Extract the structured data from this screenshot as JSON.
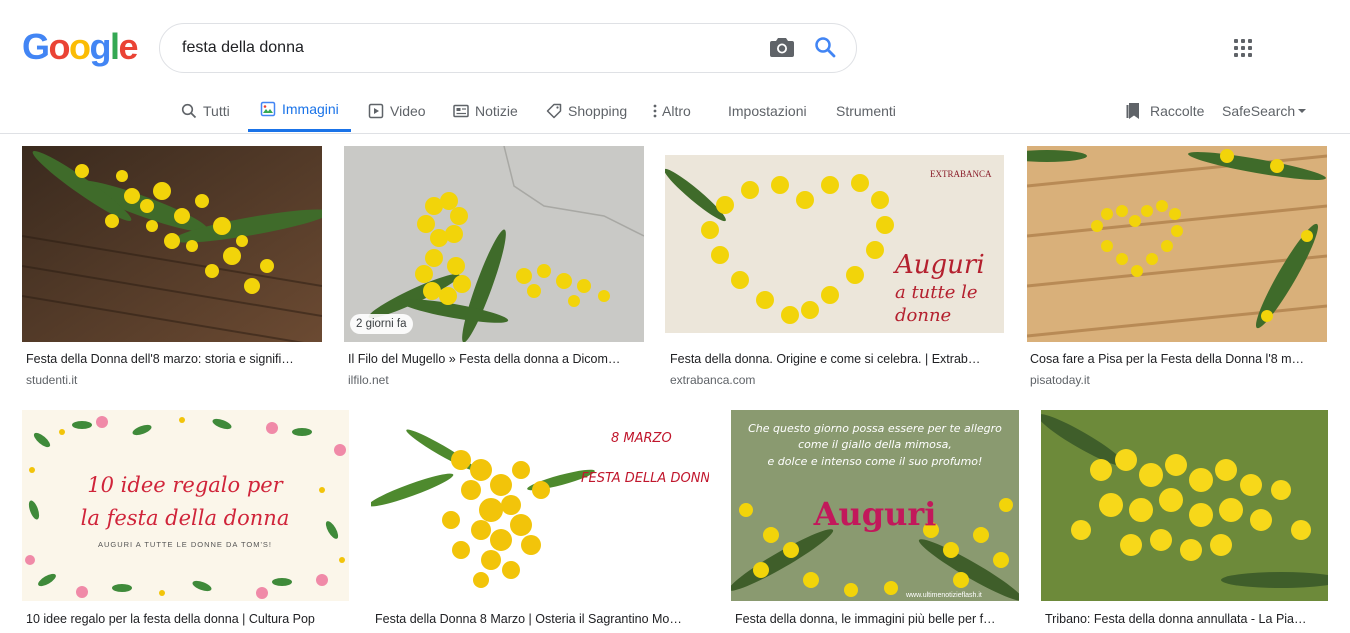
{
  "logo": {
    "letters": [
      "G",
      "o",
      "o",
      "g",
      "l",
      "e"
    ],
    "colors": [
      "#4285f4",
      "#ea4335",
      "#fbbc05",
      "#4285f4",
      "#34a853",
      "#ea4335"
    ]
  },
  "search": {
    "value": "festa della donna",
    "camera_icon": "camera-icon",
    "search_icon": "search-icon"
  },
  "apps_icon": "apps-grid-icon",
  "tabs": [
    {
      "label": "Tutti",
      "icon": "search-icon"
    },
    {
      "label": "Immagini",
      "icon": "image-icon"
    },
    {
      "label": "Video",
      "icon": "play-icon"
    },
    {
      "label": "Notizie",
      "icon": "news-icon"
    },
    {
      "label": "Shopping",
      "icon": "tag-icon"
    },
    {
      "label": "Altro",
      "icon": "more-vert-icon"
    },
    {
      "label": "Impostazioni"
    },
    {
      "label": "Strumenti"
    }
  ],
  "right_tools": {
    "collections": "Raccolte",
    "safesearch": "SafeSearch"
  },
  "colors": {
    "accent": "#1a73e8",
    "mimosa": "#f2d40a",
    "leaf": "#3f6b2a"
  },
  "results": [
    {
      "title": "Festa della Donna dell'8 marzo: storia e signifi…",
      "source": "studenti.it"
    },
    {
      "title": "Il Filo del Mugello » Festa della donna a Dicom…",
      "source": "ilfilo.net",
      "badge": "2 giorni fa"
    },
    {
      "title": "Festa della donna. Origine e come si celebra. | Extrab…",
      "source": "extrabanca.com",
      "overlay": [
        "Auguri",
        "a tutte le",
        "donne"
      ],
      "brand": "EXTRABANCA"
    },
    {
      "title": "Cosa fare a Pisa per la Festa della Donna l'8 m…",
      "source": "pisatoday.it"
    },
    {
      "title": "10 idee regalo per la festa della donna | Cultura Pop",
      "overlay": [
        "10 idee regalo per",
        "la festa della donna",
        "AUGURI A TUTTE LE DONNE DA TOM'S!"
      ]
    },
    {
      "title": "Festa della Donna 8 Marzo | Osteria il Sagrantino Mo…",
      "overlay": [
        "8 MARZO",
        "FESTA DELLA DONNA"
      ]
    },
    {
      "title": "Festa della donna, le immagini più belle per f…",
      "overlay": [
        "Che questo giorno possa essere per te allegro",
        "come il giallo della mimosa,",
        "e dolce e intenso come il suo profumo!",
        "Auguri",
        "www.ultimenotizieflash.it"
      ]
    },
    {
      "title": "Tribano: Festa della donna annullata - La Pia…"
    }
  ]
}
